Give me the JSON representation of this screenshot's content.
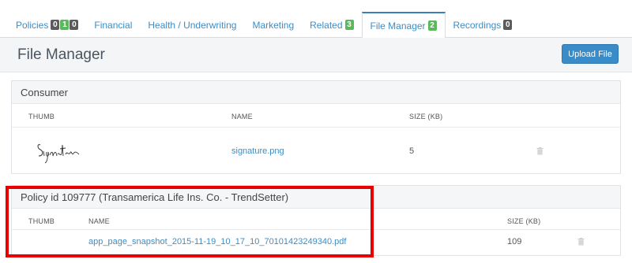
{
  "tabs": [
    {
      "label": "Policies",
      "badges": [
        "0",
        "1",
        "0"
      ],
      "badge_colors": [
        "dark",
        "green",
        "dark"
      ]
    },
    {
      "label": "Financial"
    },
    {
      "label": "Health / Underwriting"
    },
    {
      "label": "Marketing"
    },
    {
      "label": "Related",
      "badge": "3",
      "badge_color": "green"
    },
    {
      "label": "File Manager",
      "badge": "2",
      "badge_color": "green",
      "active": true
    },
    {
      "label": "Recordings",
      "badge": "0",
      "badge_color": "dark"
    }
  ],
  "header": {
    "title": "File Manager",
    "upload_label": "Upload File"
  },
  "consumer_panel": {
    "title": "Consumer",
    "columns": {
      "thumb": "THUMB",
      "name": "NAME",
      "size": "SIZE (KB)"
    },
    "rows": [
      {
        "thumb": "signature-image",
        "name": "signature.png",
        "size": "5"
      }
    ]
  },
  "policy_panel": {
    "title": "Policy id 109777 (Transamerica Life Ins. Co. - TrendSetter)",
    "columns": {
      "thumb": "THUMB",
      "name": "NAME",
      "size": "SIZE (KB)"
    },
    "rows": [
      {
        "name": "app_page_snapshot_2015-11-19_10_17_10_70101423249340.pdf",
        "size": "109"
      }
    ]
  },
  "colors": {
    "accent": "#3a8cc8",
    "link": "#3c8dc5",
    "highlight": "#e60000",
    "badge_green": "#5cb85c",
    "badge_dark": "#5b5b5b"
  }
}
